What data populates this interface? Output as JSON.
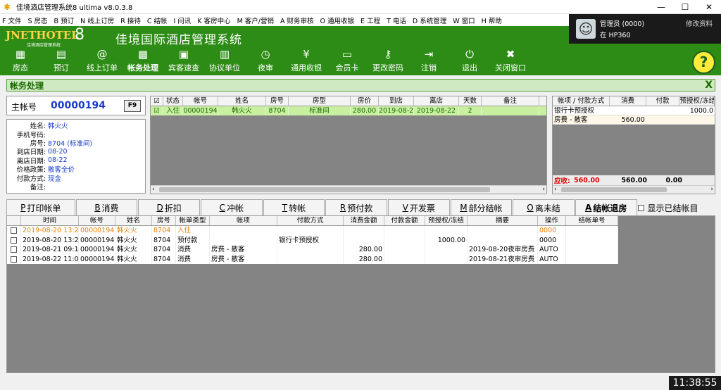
{
  "window": {
    "title": "佳境酒店管理系统8 ultima v8.0.3.8",
    "min": "—",
    "max": "☐",
    "close": "✕"
  },
  "menu": [
    "F 文件",
    "S 房态",
    "B 预订",
    "N 线上订房",
    "R 接待",
    "C 结帐",
    "I 问讯",
    "K 客房中心",
    "M 客户/营销",
    "A 财务审核",
    "O 通用收银",
    "E 工程",
    "T 电话",
    "D 系统管理",
    "W 窗口",
    "H 帮助"
  ],
  "brand": {
    "logo_text": "JNETHOTEL",
    "logo_num": "8",
    "logo_sub": "佳境酒店管理系统",
    "title": "佳境国际酒店管理系统"
  },
  "user": {
    "name": "管理员 (0000)",
    "edit": "修改资料",
    "location": "在 HP360"
  },
  "toolbar": [
    {
      "icon": "▦",
      "label": "房态"
    },
    {
      "icon": "▤",
      "label": "预订"
    },
    {
      "icon": "@",
      "label": "线上订单"
    },
    {
      "icon": "▩",
      "label": "帐务处理",
      "active": true
    },
    {
      "icon": "▣",
      "label": "宾客速查"
    },
    {
      "icon": "▥",
      "label": "协议单位"
    },
    {
      "icon": "◷",
      "label": "夜审"
    },
    {
      "icon": "¥",
      "label": "通用收银"
    },
    {
      "icon": "▭",
      "label": "会员卡"
    },
    {
      "icon": "⚷",
      "label": "更改密码"
    },
    {
      "icon": "⇥",
      "label": "注销"
    },
    {
      "icon": "⏻",
      "label": "退出"
    },
    {
      "icon": "✖",
      "label": "关闭窗口"
    }
  ],
  "help": "?",
  "section": {
    "title": "帐务处理",
    "close": "X"
  },
  "account": {
    "label": "主帐号",
    "value": "00000194",
    "f9": "F9"
  },
  "info": [
    {
      "k": "姓名:",
      "v": "韩火火"
    },
    {
      "k": "手机号码:",
      "v": ""
    },
    {
      "k": "房号:",
      "v": "8704 (标准间)"
    },
    {
      "k": "到店日期:",
      "v": "08-20"
    },
    {
      "k": "离店日期:",
      "v": "08-22"
    },
    {
      "k": "价格政策:",
      "v": "散客全价"
    },
    {
      "k": "付款方式:",
      "v": "现金"
    },
    {
      "k": "备注:",
      "v": ""
    }
  ],
  "guests": {
    "headers": [
      "☑",
      "状态",
      "帐号",
      "姓名",
      "房号",
      "房型",
      "房价",
      "到店",
      "离店",
      "天数",
      "备注"
    ],
    "rows": [
      [
        "☑",
        "入住",
        "00000194",
        "韩火火",
        "8704",
        "标准间",
        "280.00",
        "2019-08-20",
        "2019-08-22",
        "2",
        ""
      ]
    ]
  },
  "summary": {
    "headers": [
      "帐项 / 付款方式",
      "消费",
      "付款",
      "预授权/冻结"
    ],
    "rows": [
      [
        "银行卡预授权",
        "",
        "",
        "1000.0"
      ],
      [
        "房费 - 散客",
        "560.00",
        "",
        ""
      ]
    ],
    "footer": {
      "label": "应收:",
      "due": "560.00",
      "consume": "560.00",
      "paid": "0.00"
    }
  },
  "actions": [
    {
      "key": "P",
      "label": "打印帐单"
    },
    {
      "key": "B",
      "label": "消费"
    },
    {
      "key": "D",
      "label": "折扣"
    },
    {
      "key": "C",
      "label": "冲帐"
    },
    {
      "key": "T",
      "label": "转帐"
    },
    {
      "key": "R",
      "label": "预付款"
    },
    {
      "key": "V",
      "label": "开发票"
    },
    {
      "key": "M",
      "label": "部分结帐"
    },
    {
      "key": "O",
      "label": "离未结"
    },
    {
      "key": "A",
      "label": "结帐退房"
    },
    {
      "key": "",
      "label": "显示已结帐目"
    }
  ],
  "ledger": {
    "headers": [
      "",
      "时间",
      "帐号",
      "姓名",
      "房号",
      "帐单类型",
      "帐项",
      "付款方式",
      "消费金额",
      "付款金额",
      "预授权/冻结",
      "摘要",
      "操作",
      "结帐单号"
    ],
    "rows": [
      [
        "",
        "2019-08-20 13:22",
        "00000194",
        "韩火火",
        "8704",
        "入住",
        "",
        "",
        "",
        "",
        "",
        "",
        "0000",
        ""
      ],
      [
        "",
        "2019-08-20 13:23",
        "00000194",
        "韩火火",
        "8704",
        "预付款",
        "",
        "银行卡预授权",
        "",
        "",
        "1000.00",
        "",
        "0000",
        ""
      ],
      [
        "",
        "2019-08-21 09:19",
        "00000194",
        "韩火火",
        "8704",
        "消费",
        "房费 - 散客",
        "",
        "280.00",
        "",
        "",
        "2019-08-20夜审房费",
        "AUTO",
        ""
      ],
      [
        "",
        "2019-08-22 11:05",
        "00000194",
        "韩火火",
        "8704",
        "消费",
        "房费 - 散客",
        "",
        "280.00",
        "",
        "",
        "2019-08-21夜审房费",
        "AUTO",
        ""
      ]
    ]
  },
  "clock": "11:38:55",
  "colors": {
    "green": "#2d8c15",
    "highlight": "#c8f0a0",
    "orange": "#e0820a",
    "blue": "#1a3cc8"
  }
}
